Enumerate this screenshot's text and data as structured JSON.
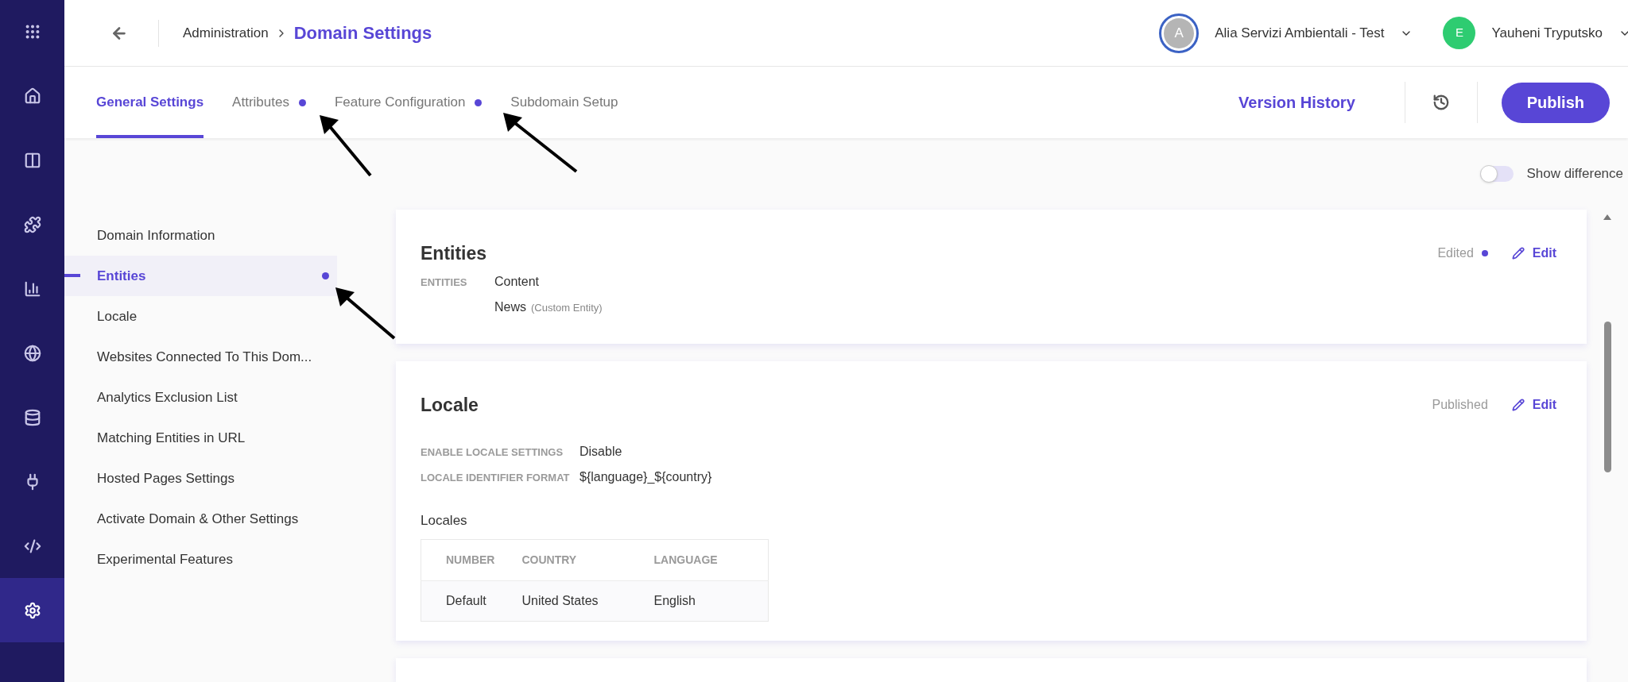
{
  "rail": [
    {
      "kind": "apps",
      "selected": false
    },
    {
      "kind": "home",
      "selected": false
    },
    {
      "kind": "layout",
      "selected": false
    },
    {
      "kind": "puzzle",
      "selected": false
    },
    {
      "kind": "chart",
      "selected": false
    },
    {
      "kind": "globe",
      "selected": false
    },
    {
      "kind": "database",
      "selected": false
    },
    {
      "kind": "plug",
      "selected": false
    },
    {
      "kind": "code",
      "selected": false
    },
    {
      "kind": "settings",
      "selected": true
    }
  ],
  "breadcrumb": {
    "parent": "Administration",
    "current": "Domain Settings"
  },
  "account": {
    "initial": "A",
    "name": "Alia Servizi Ambientali - Test"
  },
  "user": {
    "initial": "E",
    "name": "Yauheni Tryputsko",
    "color": "#2ecc71"
  },
  "tabs": [
    {
      "label": "General Settings",
      "selected": true,
      "dot": false
    },
    {
      "label": "Attributes",
      "selected": false,
      "dot": true
    },
    {
      "label": "Feature Configuration",
      "selected": false,
      "dot": true
    },
    {
      "label": "Subdomain Setup",
      "selected": false,
      "dot": false
    }
  ],
  "version_history": "Version History",
  "publish": "Publish",
  "show_difference": {
    "label": "Show difference",
    "on": false
  },
  "sections": [
    {
      "label": "Domain Information",
      "selected": false,
      "dot": false
    },
    {
      "label": "Entities",
      "selected": true,
      "dot": true
    },
    {
      "label": "Locale",
      "selected": false,
      "dot": false
    },
    {
      "label": "Websites Connected To This Dom...",
      "selected": false,
      "dot": false
    },
    {
      "label": "Analytics Exclusion List",
      "selected": false,
      "dot": false
    },
    {
      "label": "Matching Entities in URL",
      "selected": false,
      "dot": false
    },
    {
      "label": "Hosted Pages Settings",
      "selected": false,
      "dot": false
    },
    {
      "label": "Activate Domain & Other Settings",
      "selected": false,
      "dot": false
    },
    {
      "label": "Experimental Features",
      "selected": false,
      "dot": false
    }
  ],
  "cards": [
    {
      "title": "Entities",
      "status": "Edited",
      "edited": true,
      "edit": "Edit",
      "fields": [
        {
          "label": "ENTITIES",
          "values": [
            {
              "text": "Content"
            },
            {
              "text": "News",
              "note": "(Custom Entity)"
            }
          ]
        }
      ]
    },
    {
      "title": "Locale",
      "status": "Published",
      "edited": false,
      "edit": "Edit",
      "fields": [
        {
          "label": "ENABLE LOCALE SETTINGS",
          "values": [
            {
              "text": "Disable"
            }
          ]
        },
        {
          "label": "LOCALE IDENTIFIER FORMAT",
          "values": [
            {
              "text": "${language}_${country}"
            }
          ]
        }
      ],
      "table": {
        "title": "Locales",
        "columns": [
          "NUMBER",
          "COUNTRY",
          "LANGUAGE"
        ],
        "rows": [
          [
            "Default",
            "United States",
            "English"
          ]
        ]
      }
    }
  ]
}
